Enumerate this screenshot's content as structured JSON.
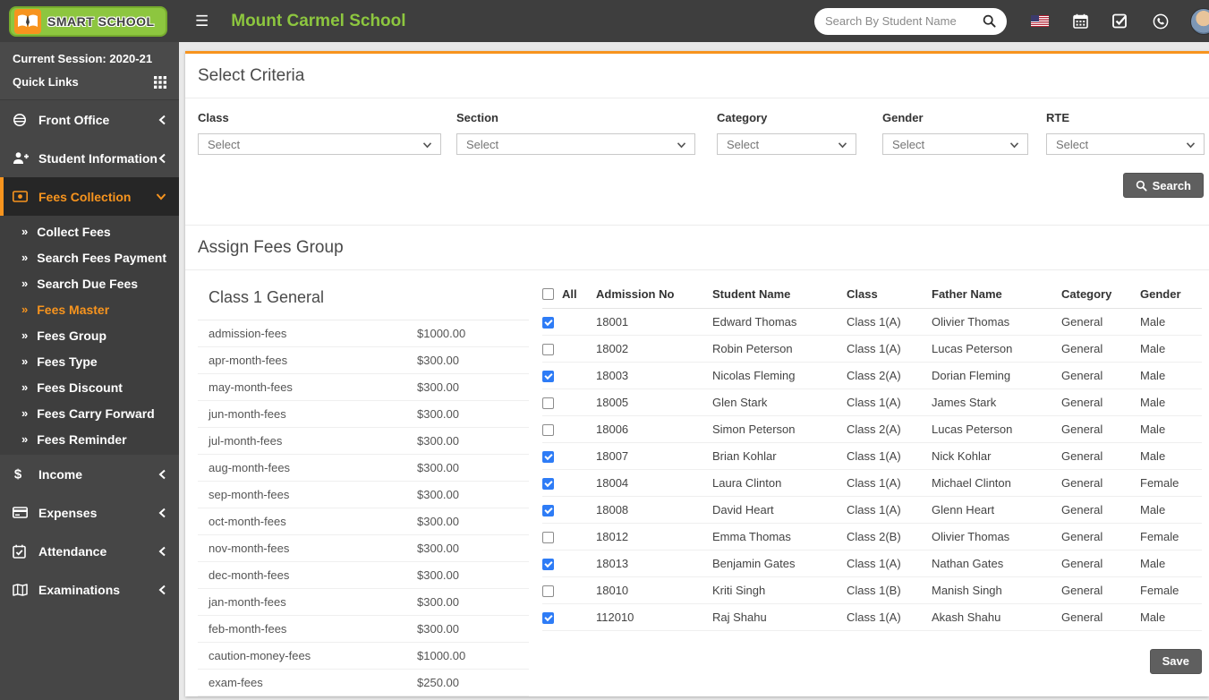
{
  "header": {
    "logo_text": "SMART SCHOOL",
    "title": "Mount Carmel School",
    "search_placeholder": "Search By Student Name"
  },
  "sidebar": {
    "session_label": "Current Session: 2020-21",
    "quick_links_label": "Quick Links",
    "items": [
      {
        "label": "Front Office",
        "icon": "front-office-icon",
        "expanded": false,
        "active": false
      },
      {
        "label": "Student Information",
        "icon": "student-icon",
        "expanded": false,
        "active": false
      },
      {
        "label": "Fees Collection",
        "icon": "fees-icon",
        "expanded": true,
        "active": true,
        "children": [
          {
            "label": "Collect Fees",
            "active": false
          },
          {
            "label": "Search Fees Payment",
            "active": false
          },
          {
            "label": "Search Due Fees",
            "active": false
          },
          {
            "label": "Fees Master",
            "active": true
          },
          {
            "label": "Fees Group",
            "active": false
          },
          {
            "label": "Fees Type",
            "active": false
          },
          {
            "label": "Fees Discount",
            "active": false
          },
          {
            "label": "Fees Carry Forward",
            "active": false
          },
          {
            "label": "Fees Reminder",
            "active": false
          }
        ]
      },
      {
        "label": "Income",
        "icon": "dollar-icon",
        "expanded": false,
        "active": false
      },
      {
        "label": "Expenses",
        "icon": "card-icon",
        "expanded": false,
        "active": false
      },
      {
        "label": "Attendance",
        "icon": "calendar-check-icon",
        "expanded": false,
        "active": false
      },
      {
        "label": "Examinations",
        "icon": "book-icon",
        "expanded": false,
        "active": false
      }
    ]
  },
  "criteria": {
    "title": "Select Criteria",
    "fields": [
      {
        "label": "Class",
        "value": "Select"
      },
      {
        "label": "Section",
        "value": "Select"
      },
      {
        "label": "Category",
        "value": "Select"
      },
      {
        "label": "Gender",
        "value": "Select"
      },
      {
        "label": "RTE",
        "value": "Select"
      }
    ],
    "search_button": "Search"
  },
  "assign": {
    "title": "Assign Fees Group",
    "group_title": "Class 1 General",
    "fees": [
      {
        "name": "admission-fees",
        "amount": "$1000.00"
      },
      {
        "name": "apr-month-fees",
        "amount": "$300.00"
      },
      {
        "name": "may-month-fees",
        "amount": "$300.00"
      },
      {
        "name": "jun-month-fees",
        "amount": "$300.00"
      },
      {
        "name": "jul-month-fees",
        "amount": "$300.00"
      },
      {
        "name": "aug-month-fees",
        "amount": "$300.00"
      },
      {
        "name": "sep-month-fees",
        "amount": "$300.00"
      },
      {
        "name": "oct-month-fees",
        "amount": "$300.00"
      },
      {
        "name": "nov-month-fees",
        "amount": "$300.00"
      },
      {
        "name": "dec-month-fees",
        "amount": "$300.00"
      },
      {
        "name": "jan-month-fees",
        "amount": "$300.00"
      },
      {
        "name": "feb-month-fees",
        "amount": "$300.00"
      },
      {
        "name": "caution-money-fees",
        "amount": "$1000.00"
      },
      {
        "name": "exam-fees",
        "amount": "$250.00"
      }
    ],
    "table": {
      "select_all_label": "All",
      "select_all_checked": false,
      "headers": [
        "Admission No",
        "Student Name",
        "Class",
        "Father Name",
        "Category",
        "Gender"
      ],
      "rows": [
        {
          "checked": true,
          "cells": [
            "18001",
            "Edward Thomas",
            "Class 1(A)",
            "Olivier Thomas",
            "General",
            "Male"
          ]
        },
        {
          "checked": false,
          "cells": [
            "18002",
            "Robin Peterson",
            "Class 1(A)",
            "Lucas Peterson",
            "General",
            "Male"
          ]
        },
        {
          "checked": true,
          "cells": [
            "18003",
            "Nicolas Fleming",
            "Class 2(A)",
            "Dorian Fleming",
            "General",
            "Male"
          ]
        },
        {
          "checked": false,
          "cells": [
            "18005",
            "Glen Stark",
            "Class 1(A)",
            "James Stark",
            "General",
            "Male"
          ]
        },
        {
          "checked": false,
          "cells": [
            "18006",
            "Simon Peterson",
            "Class 2(A)",
            "Lucas Peterson",
            "General",
            "Male"
          ]
        },
        {
          "checked": true,
          "cells": [
            "18007",
            "Brian Kohlar",
            "Class 1(A)",
            "Nick Kohlar",
            "General",
            "Male"
          ]
        },
        {
          "checked": true,
          "cells": [
            "18004",
            "Laura Clinton",
            "Class 1(A)",
            "Michael Clinton",
            "General",
            "Female"
          ]
        },
        {
          "checked": true,
          "cells": [
            "18008",
            "David Heart",
            "Class 1(A)",
            "Glenn Heart",
            "General",
            "Male"
          ]
        },
        {
          "checked": false,
          "cells": [
            "18012",
            "Emma Thomas",
            "Class 2(B)",
            "Olivier Thomas",
            "General",
            "Female"
          ]
        },
        {
          "checked": true,
          "cells": [
            "18013",
            "Benjamin Gates",
            "Class 1(A)",
            "Nathan Gates",
            "General",
            "Male"
          ]
        },
        {
          "checked": false,
          "cells": [
            "18010",
            "Kriti Singh",
            "Class 1(B)",
            "Manish Singh",
            "General",
            "Female"
          ]
        },
        {
          "checked": true,
          "cells": [
            "112010",
            "Raj Shahu",
            "Class 1(A)",
            "Akash Shahu",
            "General",
            "Male"
          ]
        }
      ]
    },
    "save_button": "Save"
  },
  "colors": {
    "accent_orange": "#f7941e",
    "brand_green": "#8dc63f",
    "checkbox_blue": "#2e7cf6",
    "header_bg": "#3e3e3e",
    "sidebar_bg": "#464646",
    "button_gray": "#5f5f5f"
  }
}
